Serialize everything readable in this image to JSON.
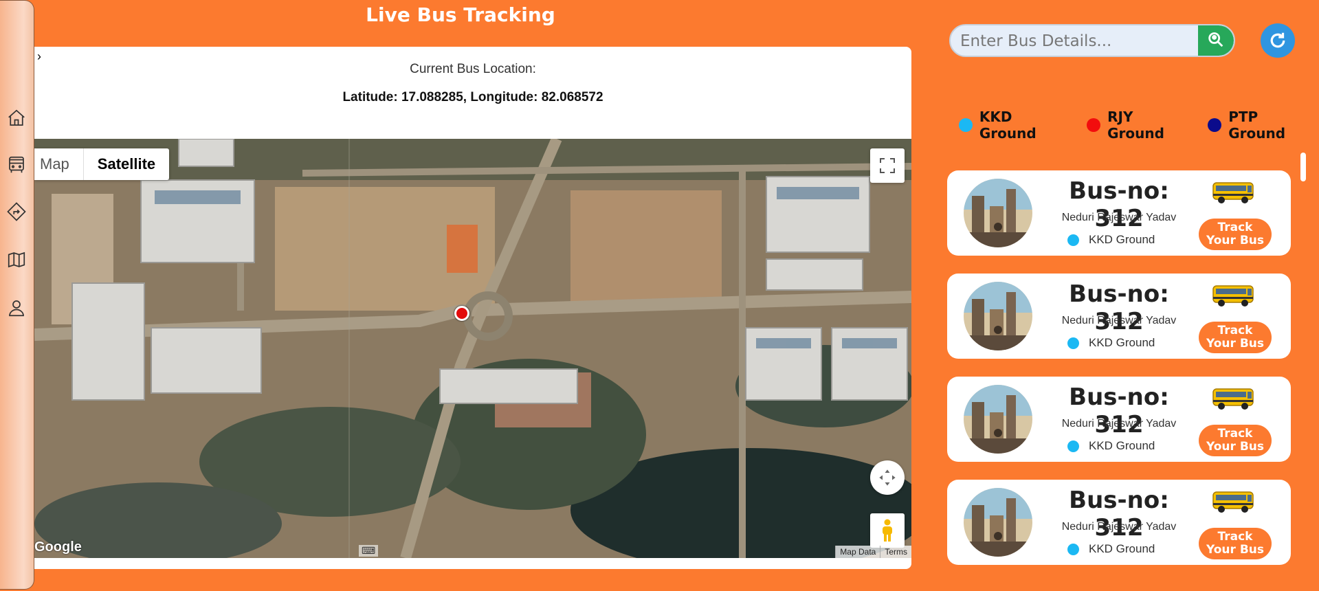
{
  "header": {
    "title": "Live Bus Tracking"
  },
  "sidebar": {
    "items": [
      "home-icon",
      "bus-icon",
      "route-icon",
      "map-icon",
      "user-icon"
    ]
  },
  "location": {
    "heading": "Current Bus Location:",
    "coords": "Latitude: 17.088285, Longitude: 82.068572",
    "latitude": 17.088285,
    "longitude": 82.068572
  },
  "map": {
    "type_map": "Map",
    "type_satellite": "Satellite",
    "selected_type": "Satellite",
    "google_logo": "Google",
    "map_data": "Map Data",
    "terms": "Terms"
  },
  "search": {
    "placeholder": "Enter Bus Details...",
    "button_icon": "search-icon"
  },
  "refresh": {
    "icon": "refresh-icon"
  },
  "legend": [
    {
      "label": "KKD Ground",
      "color": "#1bb8f3"
    },
    {
      "label": "RJY Ground",
      "color": "#f20d0d"
    },
    {
      "label": "PTP Ground",
      "color": "#0b0b8c"
    }
  ],
  "buses": [
    {
      "bus_no": "Bus-no: 312",
      "driver": "Neduri Rajeswar Yadav",
      "depot": "KKD Ground",
      "depot_color": "#1bb8f3",
      "track_label": "Track Your Bus"
    },
    {
      "bus_no": "Bus-no: 312",
      "driver": "Neduri Rajeswar Yadav",
      "depot": "KKD Ground",
      "depot_color": "#1bb8f3",
      "track_label": "Track Your Bus"
    },
    {
      "bus_no": "Bus-no: 312",
      "driver": "Neduri Rajeswar Yadav",
      "depot": "KKD Ground",
      "depot_color": "#1bb8f3",
      "track_label": "Track Your Bus"
    },
    {
      "bus_no": "Bus-no: 312",
      "driver": "Neduri Rajeswar Yadav",
      "depot": "KKD Ground",
      "depot_color": "#1bb8f3",
      "track_label": "Track Your Bus"
    }
  ],
  "colors": {
    "accent": "#fc7a2f",
    "search_button": "#27a85a",
    "refresh_button": "#2f95e0"
  }
}
